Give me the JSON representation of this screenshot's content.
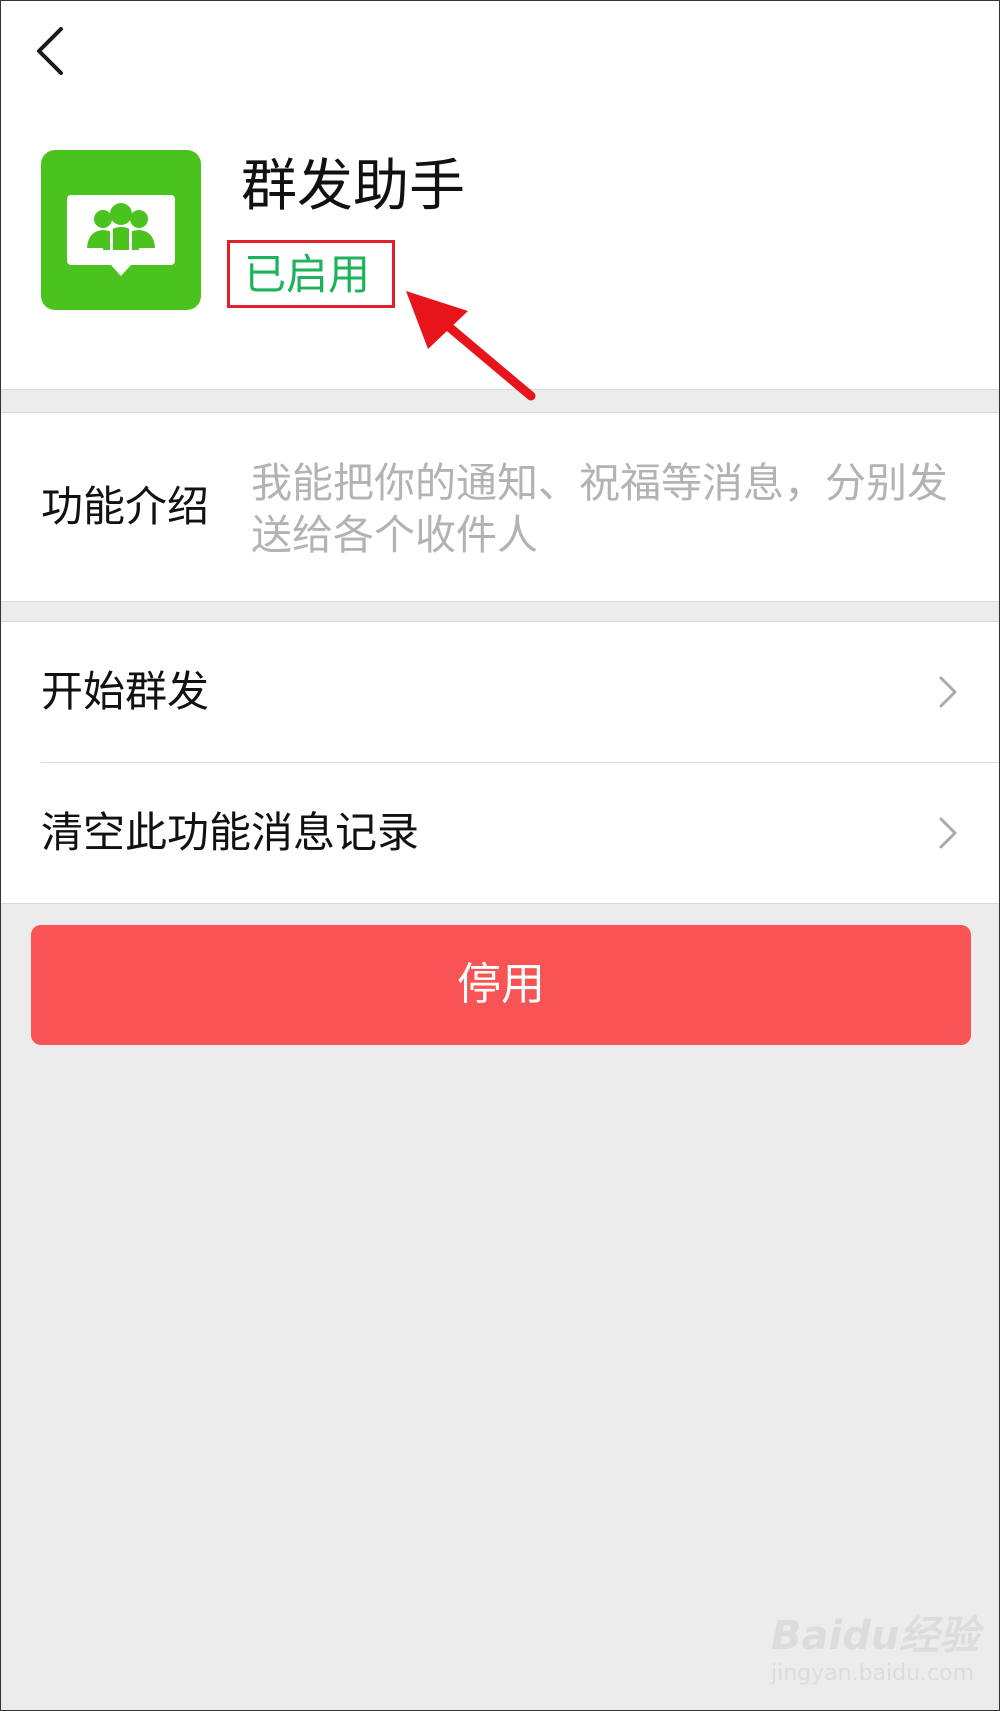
{
  "header": {
    "back_icon": "chevron-left-icon",
    "app_icon": "group-message-icon",
    "app_icon_color": "#4bc31f",
    "title": "群发助手",
    "status": "已启用",
    "status_color": "#1db25c"
  },
  "intro": {
    "label": "功能介绍",
    "description": "我能把你的通知、祝福等消息，分别发送给各个收件人"
  },
  "menu": {
    "items": [
      {
        "label": "开始群发",
        "icon": "chevron-right-icon"
      },
      {
        "label": "清空此功能消息记录",
        "icon": "chevron-right-icon"
      }
    ]
  },
  "actions": {
    "disable_label": "停用",
    "disable_color": "#f95455"
  },
  "watermark": {
    "brand": "Baidu经验",
    "url": "jingyan.baidu.com"
  }
}
